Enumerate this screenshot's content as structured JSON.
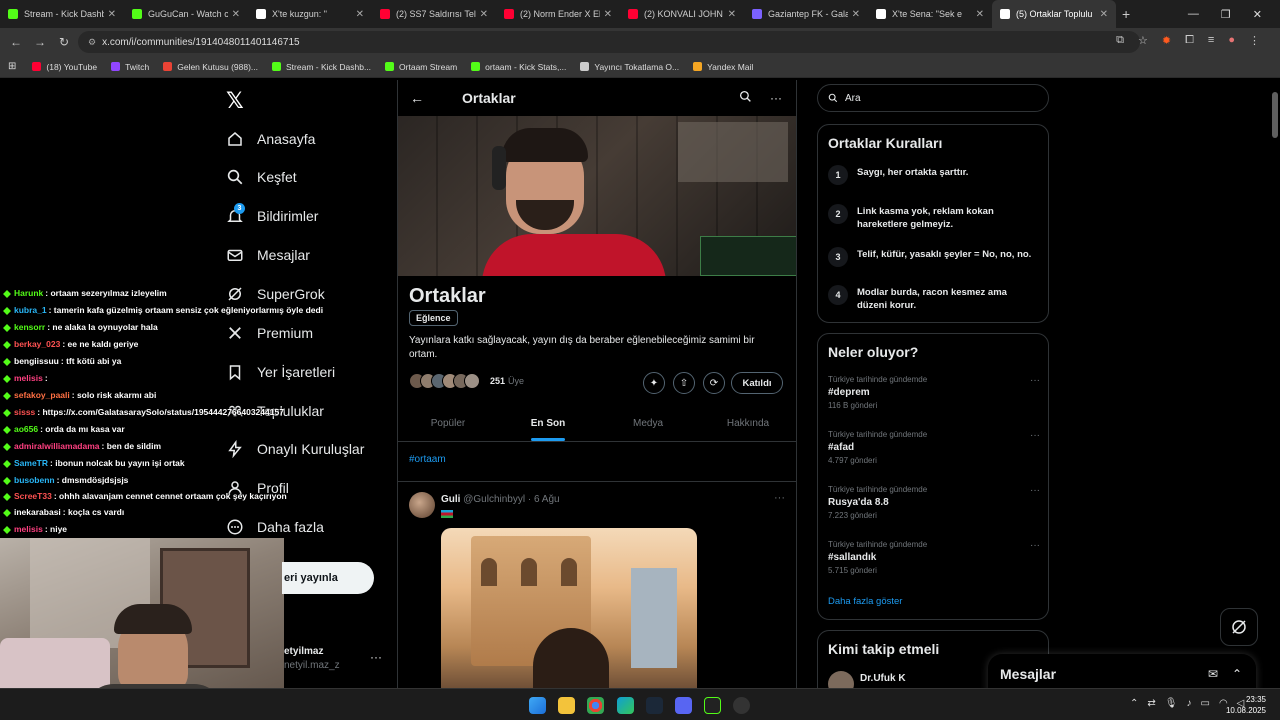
{
  "browser": {
    "tabs": [
      {
        "title": "Stream - Kick Dashbo",
        "color": "#53fc18"
      },
      {
        "title": "GuGuCan - Watch cli",
        "color": "#53fc18"
      },
      {
        "title": "X'te kuzgun: \"",
        "color": "#ffffff"
      },
      {
        "title": "(2) SS7 Saldırısı Telef",
        "color": "#ff0033"
      },
      {
        "title": "(2) Norm Ender X Eb",
        "color": "#ff0033"
      },
      {
        "title": "(2) KONVALI JOHN W",
        "color": "#ff0033"
      },
      {
        "title": "Gaziantep FK - Galat",
        "color": "#7b61ff"
      },
      {
        "title": "X'te Sena: \"Sek e",
        "color": "#ffffff"
      },
      {
        "title": "(5) Ortaklar Toplulu",
        "color": "#ffffff",
        "active": true
      }
    ],
    "new_tab": "+",
    "url": "x.com/i/communities/1914048011401146715",
    "bookmarks": [
      {
        "label": "(18) YouTube",
        "color": "#ff0033"
      },
      {
        "label": "Twitch",
        "color": "#9146ff"
      },
      {
        "label": "Gelen Kutusu (988)...",
        "color": "#ea4335"
      },
      {
        "label": "Stream - Kick Dashb...",
        "color": "#53fc18"
      },
      {
        "label": "Ortaam Stream",
        "color": "#53fc18"
      },
      {
        "label": "ortaam - Kick Stats,...",
        "color": "#53fc18"
      },
      {
        "label": "Yayıncı Tokatlama O...",
        "color": "#cccccc"
      },
      {
        "label": "Yandex Mail",
        "color": "#f5a623"
      }
    ]
  },
  "nav": {
    "items": [
      {
        "label": "Anasayfa",
        "icon": "home-icon"
      },
      {
        "label": "Keşfet",
        "icon": "search-icon"
      },
      {
        "label": "Bildirimler",
        "icon": "bell-icon",
        "badge": "3"
      },
      {
        "label": "Mesajlar",
        "icon": "mail-icon"
      },
      {
        "label": "SuperGrok",
        "icon": "grok-icon"
      },
      {
        "label": "Premium",
        "icon": "x-icon"
      },
      {
        "label": "Yer İşaretleri",
        "icon": "bookmark-icon"
      },
      {
        "label": "Topluluklar",
        "icon": "people-icon"
      },
      {
        "label": "Onaylı Kuruluşlar",
        "icon": "lightning-icon"
      },
      {
        "label": "Profil",
        "icon": "person-icon"
      },
      {
        "label": "Daha fazla",
        "icon": "more-circle-icon"
      }
    ],
    "post_button": "eri yayınla",
    "account_name": "etyilmaz",
    "account_handle": "netyil.maz_z"
  },
  "chat": [
    {
      "user": "Harunk",
      "color": "#53fc18",
      "msg": ": ortaam sezeryılmaz izleyelim"
    },
    {
      "user": "kubra_1",
      "color": "#29b6f6",
      "msg": ": tamerin kafa güzelmiş ortaam sensiz çok eğleniyorlarmış öyle dedi"
    },
    {
      "user": "kensorr",
      "color": "#53fc18",
      "msg": ": ne alaka la oynuyolar hala"
    },
    {
      "user": "berkay_023",
      "color": "#ff5252",
      "msg": ": ee ne kaldı geriye"
    },
    {
      "user": "bengiissuu",
      "color": "#ffffff",
      "msg": ": tft kötü abi ya"
    },
    {
      "user": "melisis",
      "color": "#ff4081",
      "msg": ":"
    },
    {
      "user": "sefakoy_paali",
      "color": "#ff7043",
      "msg": ": solo risk akarmı abi"
    },
    {
      "user": "sisss",
      "color": "#ff5252",
      "msg": ": https://x.com/GalatasaraySolo/status/1954442766403244157"
    },
    {
      "user": "ao656",
      "color": "#53fc18",
      "msg": ": orda da mı kasa var"
    },
    {
      "user": "admiralwilliamadama",
      "color": "#ff4081",
      "msg": ": ben de sildim"
    },
    {
      "user": "SameTR",
      "color": "#29b6f6",
      "msg": ": ibonun nolcak bu yayın işi ortak"
    },
    {
      "user": "busobenn",
      "color": "#29b6f6",
      "msg": ": dmsmdösjdsjsjs"
    },
    {
      "user": "ScreeT33",
      "color": "#ff5252",
      "msg": ": ohhh alavanjam cennet cennet ortaam çok şey kaçırıyon"
    },
    {
      "user": "inekarabasi",
      "color": "#ffffff",
      "msg": ": koçla cs vardı"
    },
    {
      "user": "melisis",
      "color": "#ff4081",
      "msg": ": niye"
    }
  ],
  "community": {
    "header_title": "Ortaklar",
    "title": "Ortaklar",
    "category": "Eğlence",
    "description": "Yayınlara katkı sağlayacak, yayın dış da beraber eğlenebileceğimiz samimi bir ortam.",
    "members_count": "251",
    "members_label": "Üye",
    "joined_label": "Katıldı",
    "tabs": [
      "Popüler",
      "En Son",
      "Medya",
      "Hakkında"
    ],
    "active_tab": "En Son",
    "hashtag": "#ortaam"
  },
  "post": {
    "author": "Guli",
    "handle": "@Gulchinbyyl",
    "separator": "·",
    "date": "6 Ağu"
  },
  "search": {
    "placeholder": "Ara"
  },
  "rules": {
    "title": "Ortaklar Kuralları",
    "items": [
      {
        "num": "1",
        "text": "Saygı, her ortakta şarttır."
      },
      {
        "num": "2",
        "text": "Link kasma yok, reklam kokan hareketlere gelmeyiz."
      },
      {
        "num": "3",
        "text": "Telif, küfür, yasaklı şeyler = No, no, no."
      },
      {
        "num": "4",
        "text": "Modlar burda, racon kesmez ama düzeni korur."
      }
    ]
  },
  "trends": {
    "title": "Neler oluyor?",
    "items": [
      {
        "category": "Türkiye tarihinde gündemde",
        "name": "#deprem",
        "count": "116 B gönderi"
      },
      {
        "category": "Türkiye tarihinde gündemde",
        "name": "#afad",
        "count": "4.797 gönderi"
      },
      {
        "category": "Türkiye tarihinde gündemde",
        "name": "Rusya'da 8.8",
        "count": "7.223 gönderi"
      },
      {
        "category": "Türkiye tarihinde gündemde",
        "name": "#sallandık",
        "count": "5.715 gönderi"
      }
    ],
    "show_more": "Daha fazla göster"
  },
  "follow": {
    "title": "Kimi takip etmeli",
    "first_user": "Dr.Ufuk K"
  },
  "messages_drawer": {
    "title": "Mesajlar"
  },
  "taskbar": {
    "time": "23:35",
    "date": "10.08.2025"
  },
  "colors": {
    "accent": "#1d9bf0",
    "kick_green": "#53fc18"
  }
}
